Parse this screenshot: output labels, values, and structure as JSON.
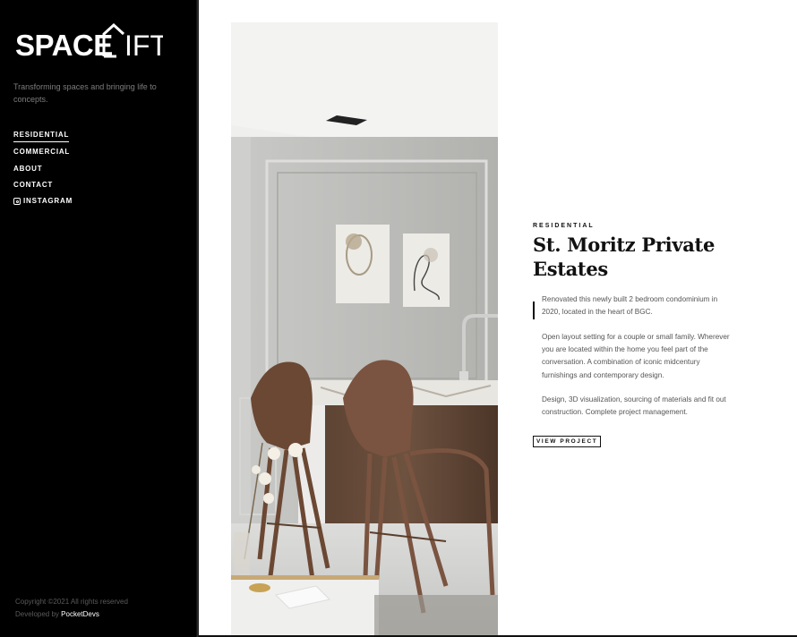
{
  "brand": {
    "logo_text": "SPACELIFT"
  },
  "sidebar": {
    "tagline": "Transforming spaces and bringing life to concepts.",
    "nav": [
      {
        "label": "RESIDENTIAL",
        "active": true
      },
      {
        "label": "COMMERCIAL"
      },
      {
        "label": "ABOUT"
      },
      {
        "label": "CONTACT"
      },
      {
        "label": "INSTAGRAM",
        "icon": "instagram-icon"
      }
    ],
    "footer": {
      "copyright": "Copyright ©2021 All rights reserved",
      "developed_by": "Developed by",
      "developer": "PocketDevs"
    }
  },
  "project": {
    "category": "RESIDENTIAL",
    "title_line1": "St. Moritz Private",
    "title_line2": "Estates",
    "paragraphs": [
      "Renovated this newly built 2 bedroom condominium in 2020, located in the heart of BGC.",
      "Open layout setting for a couple or small family. Wherever you are located within the home you feel part of the conversation. A combination of iconic midcentury furnishings and contemporary design.",
      "Design, 3D visualization, sourcing of materials and fit out construction. Complete project management."
    ],
    "cta": "VIEW PROJECT"
  },
  "colors": {
    "sidebar_bg": "#000000",
    "accent": "#111111",
    "muted": "#555555"
  }
}
